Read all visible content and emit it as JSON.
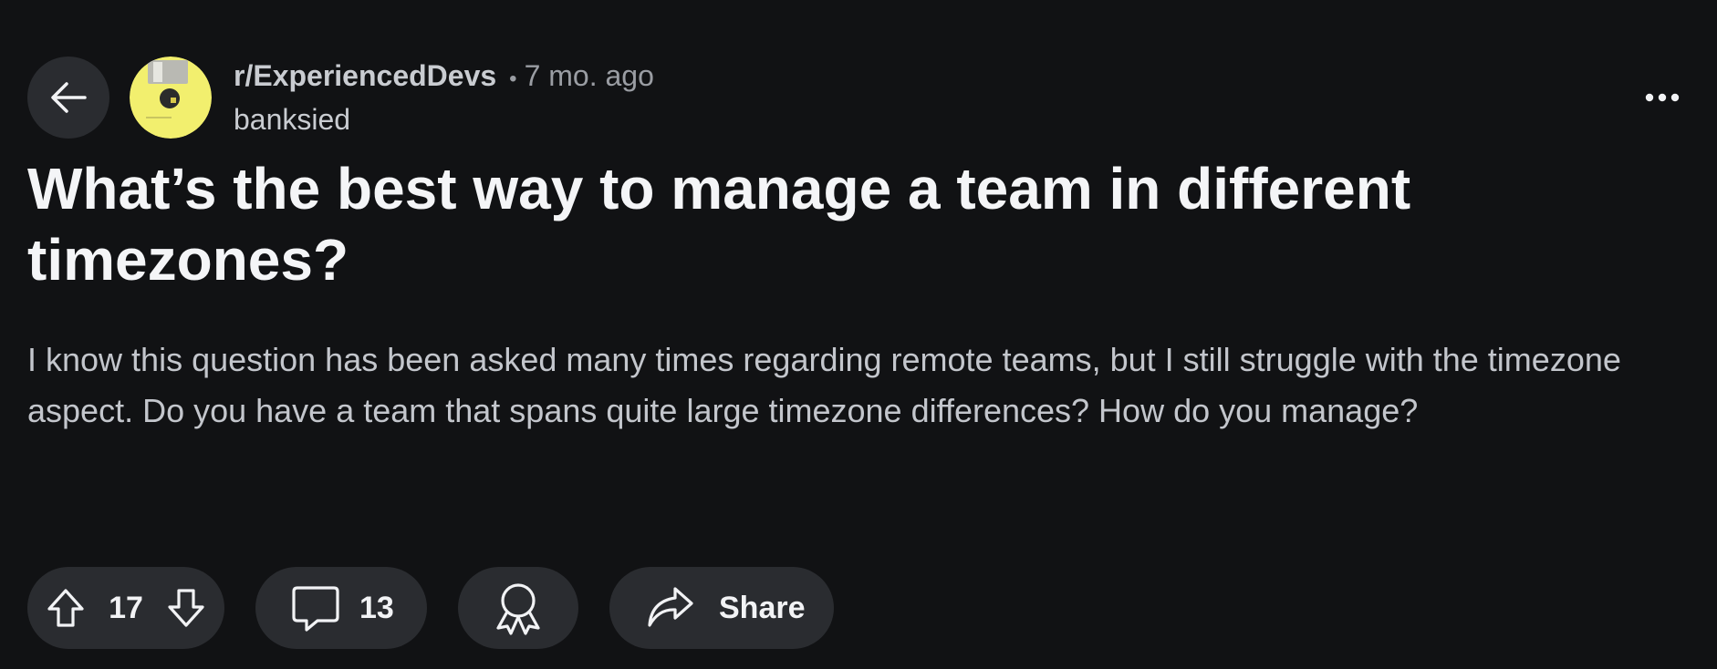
{
  "post": {
    "subreddit": "r/ExperiencedDevs",
    "separator": "•",
    "age": "7 mo. ago",
    "author": "banksied",
    "title": "What’s the best way to manage a team in different timezones?",
    "body": "I know this question has been asked many times regarding remote teams, but I still struggle with the timezone aspect. Do you have a team that spans quite large timezone differences? How do you manage?"
  },
  "actions": {
    "votes": "17",
    "comments": "13",
    "share_label": "Share"
  },
  "icons": {
    "back": "arrow-left-icon",
    "more": "more-horizontal-icon",
    "upvote": "arrow-up-icon",
    "downvote": "arrow-down-icon",
    "comment": "comment-bubble-icon",
    "award": "award-ribbon-icon",
    "share": "share-arrow-icon"
  },
  "colors": {
    "background": "#111214",
    "pill": "#2a2c30",
    "avatar": "#f2ef6e"
  }
}
